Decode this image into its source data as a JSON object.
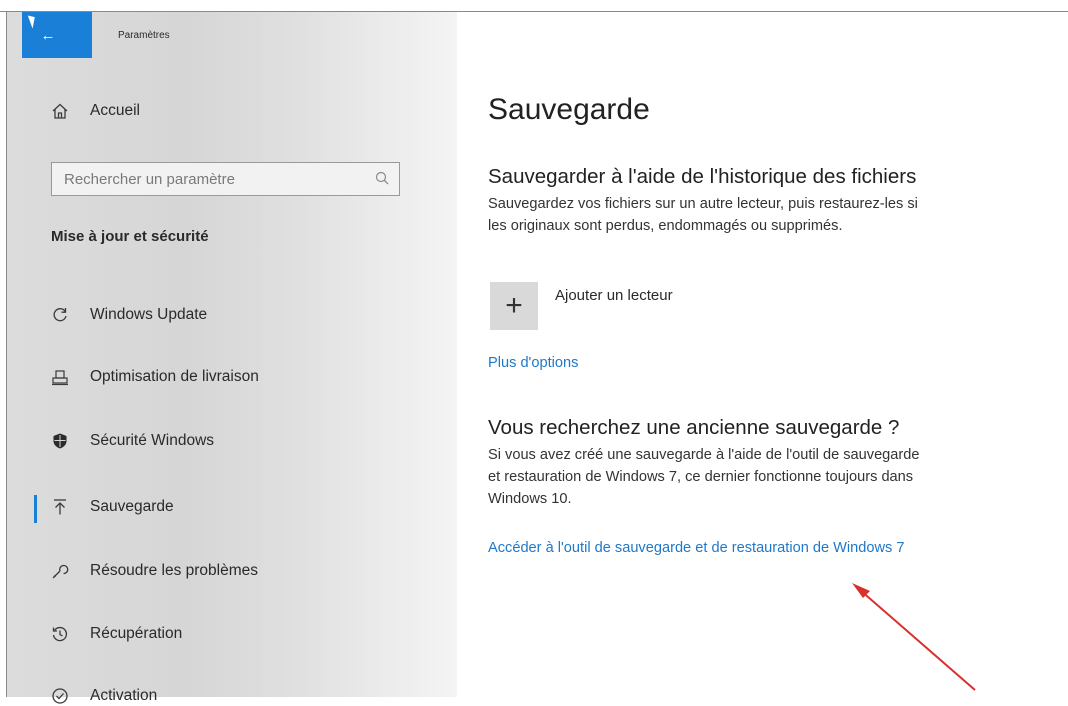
{
  "window": {
    "title": "Paramètres",
    "back_icon": "back-arrow-icon"
  },
  "sidebar": {
    "home_label": "Accueil",
    "search_placeholder": "Rechercher un paramètre",
    "section_title": "Mise à jour et sécurité",
    "items": [
      {
        "label": "Windows Update",
        "icon": "refresh-icon"
      },
      {
        "label": "Optimisation de livraison",
        "icon": "delivery-icon"
      },
      {
        "label": "Sécurité Windows",
        "icon": "shield-icon"
      },
      {
        "label": "Sauvegarde",
        "icon": "upload-icon",
        "selected": true
      },
      {
        "label": "Résoudre les problèmes",
        "icon": "wrench-icon"
      },
      {
        "label": "Récupération",
        "icon": "history-icon"
      },
      {
        "label": "Activation",
        "icon": "check-circle-icon"
      }
    ]
  },
  "main": {
    "title": "Sauvegarde",
    "file_history": {
      "heading": "Sauvegarder à l'aide de l'historique des fichiers",
      "desc_line1": "Sauvegardez vos fichiers sur un autre lecteur, puis restaurez-les si",
      "desc_line2": "les originaux sont perdus, endommagés ou supprimés.",
      "add_drive_label": "Ajouter un lecteur",
      "more_options_link": "Plus d'options"
    },
    "old_backup": {
      "heading": "Vous recherchez une ancienne sauvegarde ?",
      "desc_line1": "Si vous avez créé une sauvegarde à l'aide de l'outil de sauvegarde",
      "desc_line2": "et restauration de Windows 7, ce dernier fonctionne toujours dans",
      "desc_line3": "Windows 10.",
      "restore_link": "Accéder à l'outil de sauvegarde et de restauration de Windows 7"
    }
  },
  "colors": {
    "accent": "#1a7fd6",
    "link": "#1f78c8",
    "annotation_arrow": "#d9302c"
  }
}
